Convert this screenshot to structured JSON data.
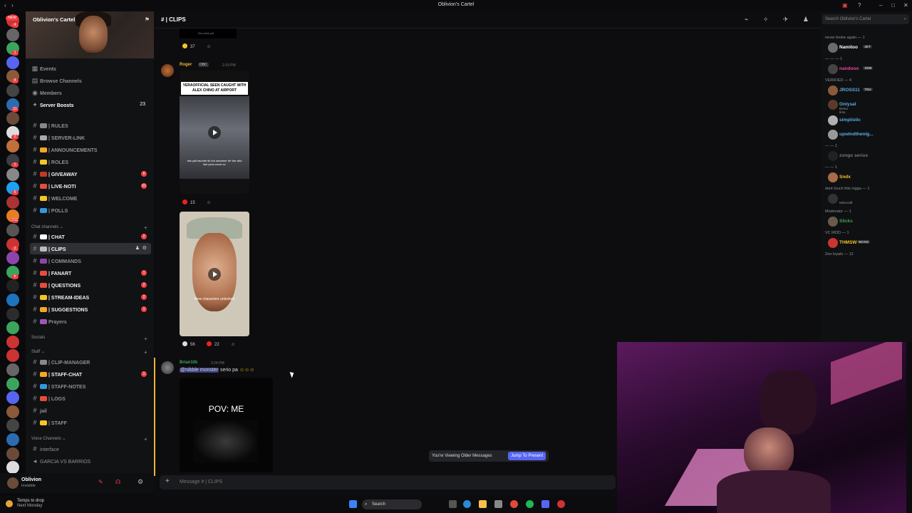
{
  "window": {
    "title": "Oblivion's Cartel"
  },
  "server": {
    "name": "Oblivion's Cartel",
    "new_badge": "NEW"
  },
  "server_rail_badges": [
    "4",
    "1",
    "1",
    "2",
    "8",
    "5",
    "11",
    "2",
    "2",
    "26",
    "1",
    "30",
    "5",
    "1",
    "211",
    "11",
    "2",
    "2",
    "b",
    "NEW"
  ],
  "menu_items": [
    {
      "label": "Events"
    },
    {
      "label": "Browse Channels"
    },
    {
      "label": "Members"
    },
    {
      "label": "Server Boosts",
      "count": "23"
    }
  ],
  "channels_top": [
    {
      "label": "| RULES",
      "color": "#888"
    },
    {
      "label": "| SERVER-LINK",
      "color": "#aaa"
    },
    {
      "label": "| ANNOUNCEMENTS",
      "color": "#f5a623"
    },
    {
      "label": "| ROLES",
      "color": "#f5c623"
    },
    {
      "label": "| GIVEAWAY",
      "color": "#c0392b",
      "badge": "6"
    },
    {
      "label": "| LIVE-NOTI",
      "color": "#e74c3c",
      "badge": "61"
    },
    {
      "label": "| WELCOME",
      "color": "#f5c623"
    },
    {
      "label": "| POLLS",
      "color": "#3498db"
    }
  ],
  "categories": {
    "chat": "Chat channels",
    "socials": "Socials",
    "staff": "Staff",
    "voice": "Voice Channels"
  },
  "channels_chat": [
    {
      "label": "| CHAT",
      "color": "#fff",
      "badge": "2"
    },
    {
      "label": "| CLIPS",
      "color": "#bbb",
      "active": true
    },
    {
      "label": "| COMMANDS",
      "color": "#8e44ad"
    },
    {
      "label": "| FANART",
      "color": "#e74c3c",
      "badge": "1"
    },
    {
      "label": "| QUESTIONS",
      "color": "#e74c3c",
      "badge": "2"
    },
    {
      "label": "| STREAM-IDEAS",
      "color": "#f5c623",
      "badge": "2"
    },
    {
      "label": "| SUGGESTIONS",
      "color": "#f5a623",
      "badge": "1"
    },
    {
      "label": "Prayers",
      "color": "#9b59b6"
    }
  ],
  "channels_staff": [
    {
      "label": "| CLIP-MANAGER",
      "color": "#888"
    },
    {
      "label": "| STAFF-CHAT",
      "color": "#f5a623",
      "badge": "1"
    },
    {
      "label": "| STAFF-NOTES",
      "color": "#3498db"
    },
    {
      "label": "| LOGS",
      "color": "#e74c3c"
    },
    {
      "label": "jail",
      "color": ""
    },
    {
      "label": "| STAFF",
      "color": "#f5c623"
    }
  ],
  "channels_voice": [
    {
      "label": "interface"
    },
    {
      "label": "GARCIA VS BARRIOS"
    }
  ],
  "user": {
    "name": "Oblivion",
    "status": "Invisible"
  },
  "weather": {
    "line1": "Temps to drop",
    "line2": "Next Monday"
  },
  "chat": {
    "channel": "| CLIPS",
    "top_caption": "No posts yet",
    "top_reaction_count": "37",
    "messages": [
      {
        "author": "Roger",
        "badge": "OBC",
        "time": "2:16 PM",
        "author_color": "#f0b232",
        "video_caption": "YERAOFFICIAL SEEN CAUGHT WITH ALEX CHINO AT AIRPORT",
        "video_sub": "this yall favorite tik tok streamer frfr the wild like yera come no",
        "reactions": [
          "15"
        ],
        "video2_caption": "New characters unlocked",
        "video2_reactions": [
          "56",
          "22"
        ]
      },
      {
        "author": "Brian10k",
        "time": "2:24 PM",
        "author_color": "#3ba55d",
        "mention": "@nibble monster",
        "text": "serio pa",
        "video_caption": "POV: ME"
      }
    ]
  },
  "older_bar": {
    "text": "You're Viewing Older Messages",
    "jump": "Jump To Present"
  },
  "composer": {
    "placeholder": "Message # | CLIPS"
  },
  "search": {
    "placeholder": "Search Oblivion's Cartel"
  },
  "members": [
    {
      "group": "never broke again — 1"
    },
    {
      "name": "Namitoo",
      "color": "#ffffff",
      "tag": "4KT"
    },
    {
      "group": "— — — 1"
    },
    {
      "name": "nandooo",
      "color": "#eb459e",
      "tag": "SDM"
    },
    {
      "group": "VERIFIED — 4"
    },
    {
      "name": "JROSS11",
      "color": "#5dade2",
      "tag": "TDU"
    },
    {
      "name": "Onlysal",
      "color": "#5dade2",
      "sub": "Demo time"
    },
    {
      "name": "simplistic",
      "color": "#5dade2"
    },
    {
      "name": "upwindthenig...",
      "color": "#5dade2"
    },
    {
      "group": "— — 1"
    },
    {
      "name": "zongo serios",
      "color": "#777"
    },
    {
      "group": "— — 1"
    },
    {
      "name": "Sndx",
      "color": "#f5c623"
    },
    {
      "group": "dont touch this nigga — 1"
    },
    {
      "name": "",
      "color": "#3ba55d",
      "sub": "Minecraft"
    },
    {
      "group": "Moderator — 1"
    },
    {
      "name": "Slicks",
      "color": "#3ba55d"
    },
    {
      "group": "VC MOD — 1"
    },
    {
      "name": "THMSW",
      "color": "#f5c623",
      "tag": "WCKD"
    },
    {
      "group": "Zeo loyals — 12"
    }
  ],
  "taskbar": {
    "search": "Search"
  },
  "colors": {
    "accent": "#5865f2",
    "mention_bg": "#3c4270",
    "unread": "#f23f43"
  }
}
